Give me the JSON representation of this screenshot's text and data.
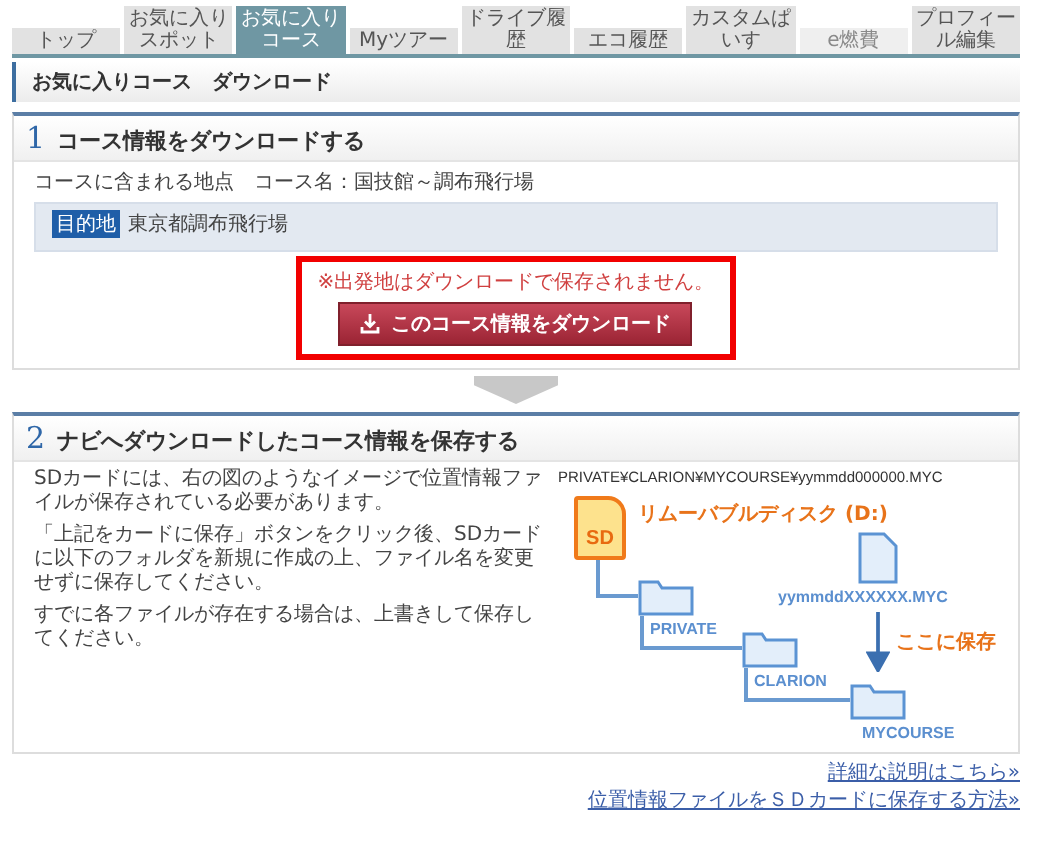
{
  "tabs": [
    {
      "label": "トップ",
      "selected": false,
      "disabled": false
    },
    {
      "label": "お気に入りスポット",
      "selected": false,
      "disabled": false
    },
    {
      "label": "お気に入りコース",
      "selected": true,
      "disabled": false
    },
    {
      "label": "Myツアー",
      "selected": false,
      "disabled": false
    },
    {
      "label": "ドライブ履歴",
      "selected": false,
      "disabled": false
    },
    {
      "label": "エコ履歴",
      "selected": false,
      "disabled": false
    },
    {
      "label": "カスタムぱいす",
      "selected": false,
      "disabled": false
    },
    {
      "label": "e燃費",
      "selected": false,
      "disabled": true
    },
    {
      "label": "プロフィール編集",
      "selected": false,
      "disabled": false
    }
  ],
  "page_title": "お気に入りコース　ダウンロード",
  "section1": {
    "number": "1",
    "title": "コース情報をダウンロードする",
    "course_label": "コースに含まれる地点",
    "course_name": "コース名：国技館～調布飛行場",
    "points": [
      {
        "badge": "目的地",
        "name": "東京都調布飛行場"
      }
    ],
    "note": "※出発地はダウンロードで保存されません。",
    "download_button": "このコース情報をダウンロード"
  },
  "section2": {
    "number": "2",
    "title": "ナビへダウンロードしたコース情報を保存する",
    "paragraphs": [
      "SDカードには、右の図のようなイメージで位置情報ファイルが保存されている必要があります。",
      "「上記をカードに保存」ボタンをクリック後、SDカードに以下のフォルダを新規に作成の上、ファイル名を変更せずに保存してください。",
      "すでに各ファイルが存在する場合は、上書きして保存してください。"
    ],
    "diagram": {
      "path": "PRIVATE¥CLARION¥MYCOURSE¥yymmdd000000.MYC",
      "drive_label": "SD",
      "drive_name": "リムーバブルディスク (D:)",
      "folders": [
        "PRIVATE",
        "CLARION",
        "MYCOURSE"
      ],
      "file": "yymmddXXXXXX.MYC",
      "save_here": "ここに保存"
    }
  },
  "links": [
    "詳細な説明はこちら»",
    "位置情報ファイルをＳＤカードに保存する方法»"
  ]
}
